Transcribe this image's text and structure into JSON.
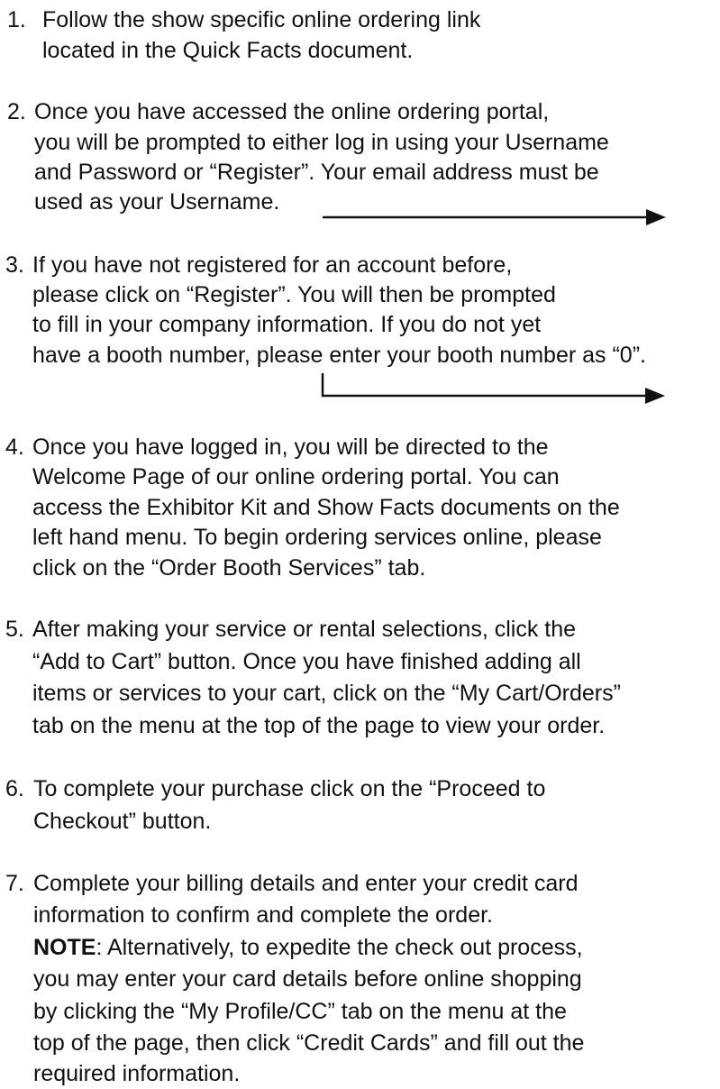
{
  "steps": [
    {
      "number": "1.",
      "lines": [
        "Follow the show specific online ordering link",
        "located in the Quick Facts document."
      ]
    },
    {
      "number": "2.",
      "lines": [
        "Once you have accessed the online ordering portal,",
        "you will be prompted to either log in using your Username",
        "and Password or “Register”. Your email address must be",
        "used as your Username."
      ]
    },
    {
      "number": "3.",
      "lines": [
        "If you have not registered for an account before,",
        "please click on “Register”. You will then be prompted",
        "to fill in your company information. If you do not yet",
        "have a booth number, please enter your booth number as “0”."
      ]
    },
    {
      "number": "4.",
      "lines": [
        "Once you have logged in, you will be directed to the",
        "Welcome Page of our online ordering portal. You can",
        "access the Exhibitor Kit and Show Facts documents on the",
        "left hand menu. To begin ordering services online, please",
        "click on the “Order Booth Services” tab."
      ]
    },
    {
      "number": "5.",
      "lines": [
        "After making your service or rental selections, click the",
        "“Add to Cart” button. Once you have finished adding all",
        "items or services to your cart, click on the “My Cart/Orders”",
        "tab on the menu at the top of the page to view your order."
      ]
    },
    {
      "number": "6.",
      "lines": [
        "To complete your purchase click on the “Proceed to",
        "Checkout” button."
      ]
    },
    {
      "number": "7.",
      "lines": [
        "Complete your billing details and enter your credit card",
        "information to confirm and complete the order."
      ],
      "note_label": "NOTE",
      "note_lines": [
        ": Alternatively, to expedite the check out process,",
        "you may enter your card details before online shopping",
        "by clicking the “My Profile/CC” tab on the menu at the",
        "top of the page, then click “Credit Cards” and fill out the",
        "required information."
      ]
    }
  ]
}
